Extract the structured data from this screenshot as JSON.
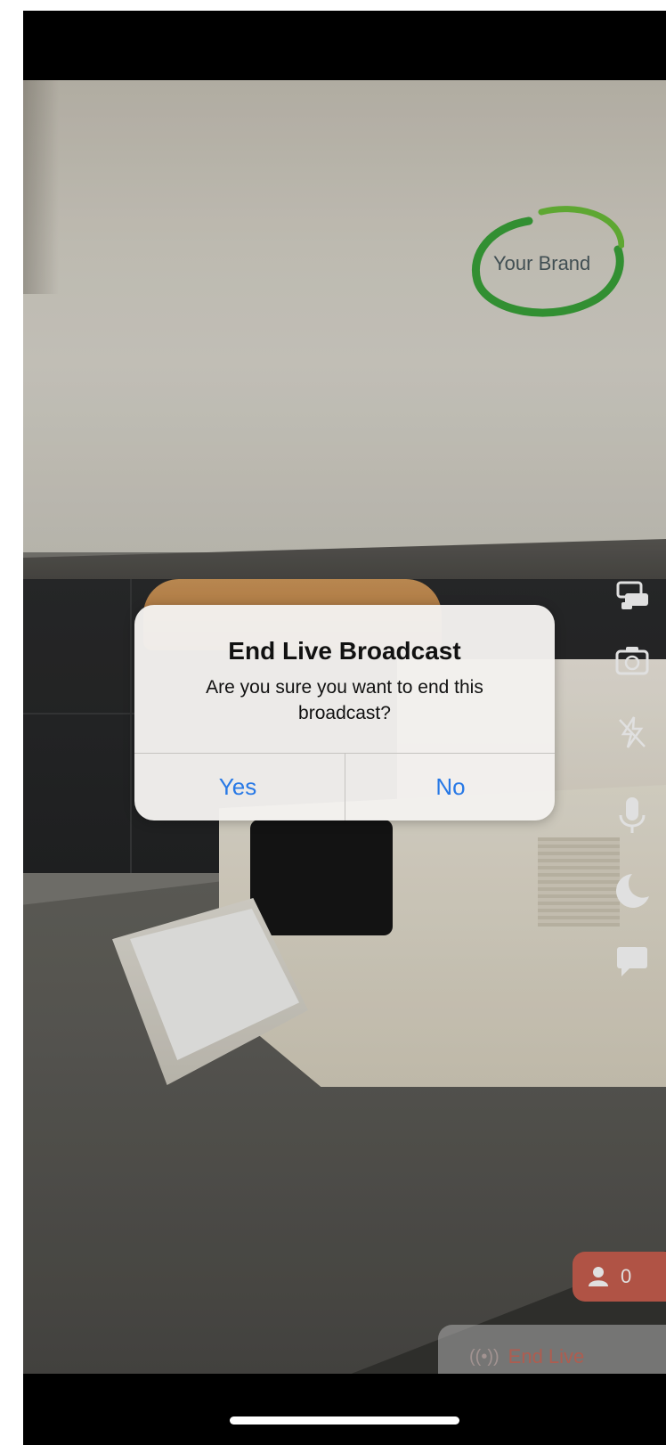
{
  "logo": {
    "text": "Your Brand",
    "ring_color": "#3aa33a"
  },
  "right_controls": [
    {
      "icon": "chat-bubbles-icon"
    },
    {
      "icon": "camera-switch-icon"
    },
    {
      "icon": "flash-off-icon"
    },
    {
      "icon": "microphone-icon"
    },
    {
      "icon": "moon-icon"
    },
    {
      "icon": "comment-icon"
    }
  ],
  "viewers": {
    "icon": "person-icon",
    "count": "0",
    "badge_color": "#c95f4f"
  },
  "end_live": {
    "icon": "broadcast-icon",
    "glyph": "((•))",
    "label": "End Live"
  },
  "alert": {
    "title": "End Live Broadcast",
    "message": "Are you sure you want to end this broadcast?",
    "yes_label": "Yes",
    "no_label": "No",
    "button_color": "#2879e6"
  }
}
